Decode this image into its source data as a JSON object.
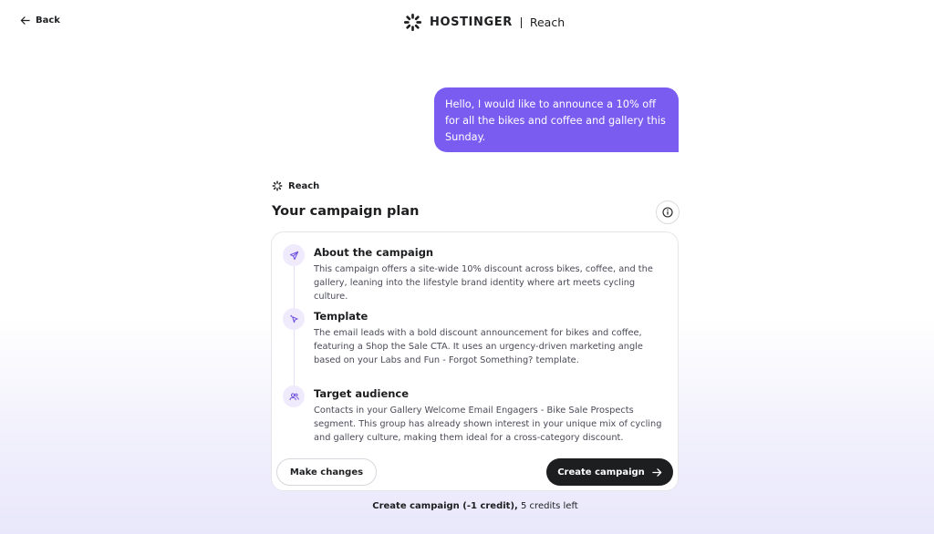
{
  "nav": {
    "back_label": "Back",
    "back_icon": "arrow-left-icon"
  },
  "brand": {
    "name": "HOSTINGER",
    "product": "Reach",
    "logo_icon": "hostinger-spinner-logo"
  },
  "chat": {
    "user_message": "Hello, I would like to announce a 10% off for all the bikes and coffee and gallery this Sunday."
  },
  "assistant": {
    "label": "Reach"
  },
  "plan": {
    "title": "Your campaign plan",
    "sections": [
      {
        "icon": "send-icon",
        "title": "About the campaign",
        "body": "This campaign offers a site-wide 10% discount across bikes, coffee, and the gallery, leaning into the lifestyle brand identity where art meets cycling culture."
      },
      {
        "icon": "template-cursor-icon",
        "title": "Template",
        "body": "The email leads with a bold discount announcement for bikes and coffee, featuring a Shop the Sale CTA. It uses an urgency-driven marketing angle based on your Labs and Fun - Forgot Something? template."
      },
      {
        "icon": "users-icon",
        "title": "Target audience",
        "body": "Contacts in your Gallery Welcome Email Engagers - Bike Sale Prospects segment. This group has already shown interest in your unique mix of cycling and gallery culture, making them ideal for a cross-category discount."
      }
    ],
    "make_changes_label": "Make changes",
    "create_campaign_label": "Create campaign"
  },
  "footer": {
    "credit_strong": "Create campaign (-1 credit),",
    "credit_rest": " 5 credits left"
  },
  "colors": {
    "accent": "#7b5cf0",
    "accent_soft": "#efebfd",
    "dark": "#1d1e20"
  }
}
